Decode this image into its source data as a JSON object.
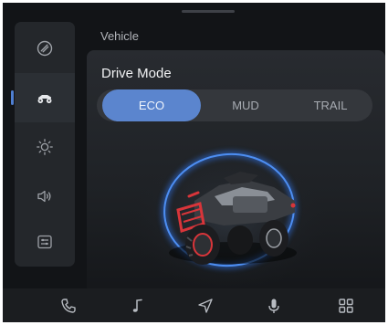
{
  "header": {
    "section_title": "Vehicle"
  },
  "sidebar": {
    "items": [
      {
        "icon": "tire-icon",
        "active": false
      },
      {
        "icon": "atv-icon",
        "active": true
      },
      {
        "icon": "brightness-icon",
        "active": false
      },
      {
        "icon": "volume-icon",
        "active": false
      },
      {
        "icon": "settings-panel-icon",
        "active": false
      }
    ]
  },
  "drive_mode": {
    "title": "Drive Mode",
    "modes": [
      "ECO",
      "MUD",
      "TRAIL"
    ],
    "selected": "ECO"
  },
  "bottom_nav": {
    "items": [
      "phone-icon",
      "music-icon",
      "navigation-icon",
      "microphone-icon",
      "apps-grid-icon"
    ]
  },
  "colors": {
    "accent": "#5b85ce",
    "background": "#121417",
    "vehicle_accent": "#d8353a",
    "ring_glow": "#3f7fe6"
  }
}
